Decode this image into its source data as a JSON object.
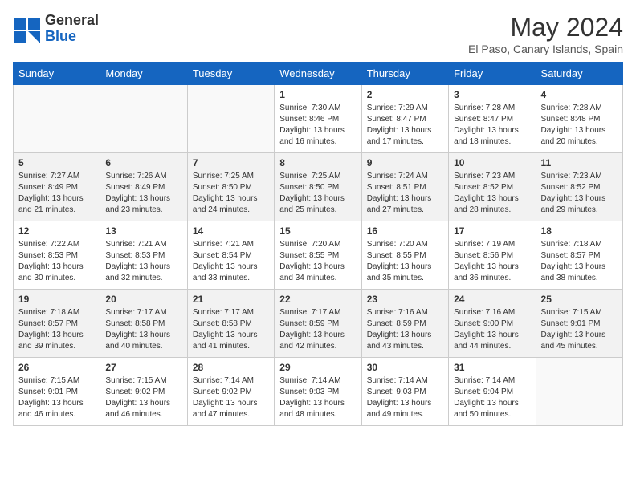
{
  "header": {
    "logo_general": "General",
    "logo_blue": "Blue",
    "month_title": "May 2024",
    "location": "El Paso, Canary Islands, Spain"
  },
  "days_of_week": [
    "Sunday",
    "Monday",
    "Tuesday",
    "Wednesday",
    "Thursday",
    "Friday",
    "Saturday"
  ],
  "weeks": [
    [
      {
        "day": "",
        "info": ""
      },
      {
        "day": "",
        "info": ""
      },
      {
        "day": "",
        "info": ""
      },
      {
        "day": "1",
        "info": "Sunrise: 7:30 AM\nSunset: 8:46 PM\nDaylight: 13 hours\nand 16 minutes."
      },
      {
        "day": "2",
        "info": "Sunrise: 7:29 AM\nSunset: 8:47 PM\nDaylight: 13 hours\nand 17 minutes."
      },
      {
        "day": "3",
        "info": "Sunrise: 7:28 AM\nSunset: 8:47 PM\nDaylight: 13 hours\nand 18 minutes."
      },
      {
        "day": "4",
        "info": "Sunrise: 7:28 AM\nSunset: 8:48 PM\nDaylight: 13 hours\nand 20 minutes."
      }
    ],
    [
      {
        "day": "5",
        "info": "Sunrise: 7:27 AM\nSunset: 8:49 PM\nDaylight: 13 hours\nand 21 minutes."
      },
      {
        "day": "6",
        "info": "Sunrise: 7:26 AM\nSunset: 8:49 PM\nDaylight: 13 hours\nand 23 minutes."
      },
      {
        "day": "7",
        "info": "Sunrise: 7:25 AM\nSunset: 8:50 PM\nDaylight: 13 hours\nand 24 minutes."
      },
      {
        "day": "8",
        "info": "Sunrise: 7:25 AM\nSunset: 8:50 PM\nDaylight: 13 hours\nand 25 minutes."
      },
      {
        "day": "9",
        "info": "Sunrise: 7:24 AM\nSunset: 8:51 PM\nDaylight: 13 hours\nand 27 minutes."
      },
      {
        "day": "10",
        "info": "Sunrise: 7:23 AM\nSunset: 8:52 PM\nDaylight: 13 hours\nand 28 minutes."
      },
      {
        "day": "11",
        "info": "Sunrise: 7:23 AM\nSunset: 8:52 PM\nDaylight: 13 hours\nand 29 minutes."
      }
    ],
    [
      {
        "day": "12",
        "info": "Sunrise: 7:22 AM\nSunset: 8:53 PM\nDaylight: 13 hours\nand 30 minutes."
      },
      {
        "day": "13",
        "info": "Sunrise: 7:21 AM\nSunset: 8:53 PM\nDaylight: 13 hours\nand 32 minutes."
      },
      {
        "day": "14",
        "info": "Sunrise: 7:21 AM\nSunset: 8:54 PM\nDaylight: 13 hours\nand 33 minutes."
      },
      {
        "day": "15",
        "info": "Sunrise: 7:20 AM\nSunset: 8:55 PM\nDaylight: 13 hours\nand 34 minutes."
      },
      {
        "day": "16",
        "info": "Sunrise: 7:20 AM\nSunset: 8:55 PM\nDaylight: 13 hours\nand 35 minutes."
      },
      {
        "day": "17",
        "info": "Sunrise: 7:19 AM\nSunset: 8:56 PM\nDaylight: 13 hours\nand 36 minutes."
      },
      {
        "day": "18",
        "info": "Sunrise: 7:18 AM\nSunset: 8:57 PM\nDaylight: 13 hours\nand 38 minutes."
      }
    ],
    [
      {
        "day": "19",
        "info": "Sunrise: 7:18 AM\nSunset: 8:57 PM\nDaylight: 13 hours\nand 39 minutes."
      },
      {
        "day": "20",
        "info": "Sunrise: 7:17 AM\nSunset: 8:58 PM\nDaylight: 13 hours\nand 40 minutes."
      },
      {
        "day": "21",
        "info": "Sunrise: 7:17 AM\nSunset: 8:58 PM\nDaylight: 13 hours\nand 41 minutes."
      },
      {
        "day": "22",
        "info": "Sunrise: 7:17 AM\nSunset: 8:59 PM\nDaylight: 13 hours\nand 42 minutes."
      },
      {
        "day": "23",
        "info": "Sunrise: 7:16 AM\nSunset: 8:59 PM\nDaylight: 13 hours\nand 43 minutes."
      },
      {
        "day": "24",
        "info": "Sunrise: 7:16 AM\nSunset: 9:00 PM\nDaylight: 13 hours\nand 44 minutes."
      },
      {
        "day": "25",
        "info": "Sunrise: 7:15 AM\nSunset: 9:01 PM\nDaylight: 13 hours\nand 45 minutes."
      }
    ],
    [
      {
        "day": "26",
        "info": "Sunrise: 7:15 AM\nSunset: 9:01 PM\nDaylight: 13 hours\nand 46 minutes."
      },
      {
        "day": "27",
        "info": "Sunrise: 7:15 AM\nSunset: 9:02 PM\nDaylight: 13 hours\nand 46 minutes."
      },
      {
        "day": "28",
        "info": "Sunrise: 7:14 AM\nSunset: 9:02 PM\nDaylight: 13 hours\nand 47 minutes."
      },
      {
        "day": "29",
        "info": "Sunrise: 7:14 AM\nSunset: 9:03 PM\nDaylight: 13 hours\nand 48 minutes."
      },
      {
        "day": "30",
        "info": "Sunrise: 7:14 AM\nSunset: 9:03 PM\nDaylight: 13 hours\nand 49 minutes."
      },
      {
        "day": "31",
        "info": "Sunrise: 7:14 AM\nSunset: 9:04 PM\nDaylight: 13 hours\nand 50 minutes."
      },
      {
        "day": "",
        "info": ""
      }
    ]
  ]
}
